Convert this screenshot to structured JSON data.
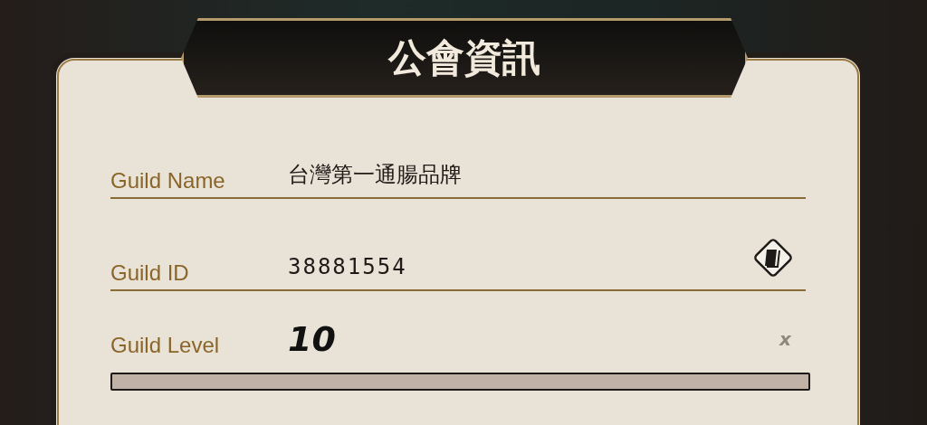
{
  "title": "公會資訊",
  "fields": [
    {
      "label": "Guild Name",
      "value": "台灣第一通腸品牌",
      "kind": "name"
    },
    {
      "label": "Guild ID",
      "value": "38881554",
      "kind": "id"
    }
  ],
  "level": {
    "label": "Guild Level",
    "value": "10",
    "suffix": "x",
    "level": 0
  }
}
